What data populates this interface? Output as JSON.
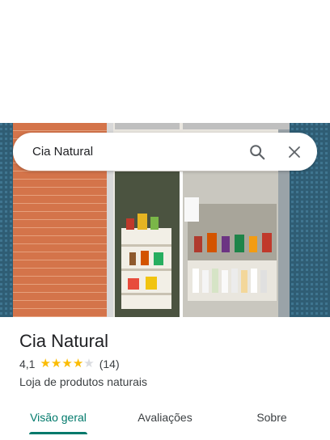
{
  "search": {
    "query": "Cia Natural",
    "icons": {
      "search": "search-icon",
      "close": "close-icon"
    }
  },
  "place": {
    "name": "Cia Natural",
    "rating": "4,1",
    "stars": {
      "value": 4.1,
      "max": 5
    },
    "review_count": "(14)",
    "category": "Loja de produtos naturais"
  },
  "tabs": [
    {
      "label": "Visão geral",
      "active": true
    },
    {
      "label": "Avaliações",
      "active": false
    },
    {
      "label": "Sobre",
      "active": false
    }
  ],
  "colors": {
    "accent": "#00796b",
    "star": "#fbbc04",
    "star_empty": "#dadce0"
  }
}
